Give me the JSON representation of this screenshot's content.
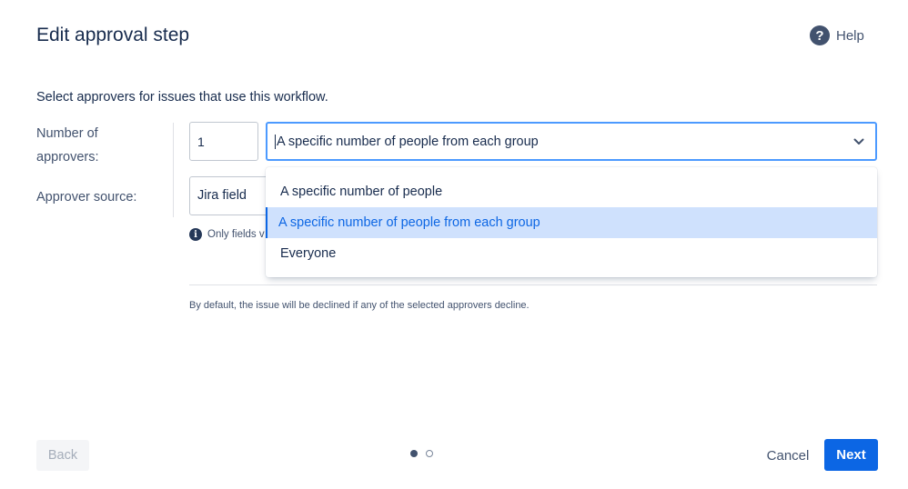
{
  "header": {
    "title": "Edit approval step",
    "help_label": "Help",
    "help_glyph": "?"
  },
  "intro": "Select approvers for issues that use this workflow.",
  "form": {
    "number_label": "Number of approvers:",
    "number_value": "1",
    "mode_select": {
      "value": "A specific number of people from each group",
      "options": [
        "A specific number of people",
        "A specific number of people from each group",
        "Everyone"
      ],
      "selected_index": 1
    },
    "source_label": "Approver source:",
    "source_value": "Jira field",
    "info_text": "Only fields v",
    "info_glyph": "i"
  },
  "decline_note": "By default, the issue will be declined if any of the selected approvers decline.",
  "footer": {
    "back_label": "Back",
    "cancel_label": "Cancel",
    "next_label": "Next",
    "steps_total": 2,
    "current_step": 1
  },
  "colors": {
    "primary": "#0c66e4",
    "focus_border": "#4c9aff",
    "selected_option_bg": "#cfe1fd",
    "text": "#172b4d",
    "subtle_text": "#42526e"
  }
}
